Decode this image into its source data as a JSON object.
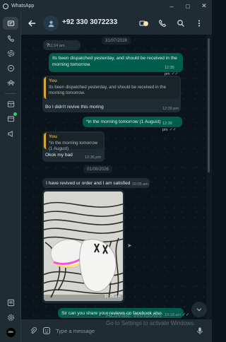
{
  "window": {
    "title": "WhatsApp",
    "controls": [
      "minimize",
      "maximize",
      "close"
    ]
  },
  "colors": {
    "accent": "#25d366",
    "bubble_out": "#005c4b",
    "bubble_in": "#202c33",
    "quote_bar": "#d9a433",
    "read_ticks": "#53bdeb"
  },
  "rail": {
    "top_icons": [
      "chats-icon",
      "calls-icon",
      "status-icon",
      "channels-icon",
      "communities-icon"
    ],
    "mid_icons": [
      "archive-icon",
      "starred-icon",
      "broadcast-icon"
    ],
    "bottom_icons": [
      "media-icon",
      "settings-icon",
      "profile-avatar"
    ],
    "profile_text": "ZEN"
  },
  "header": {
    "contact_name": "+92 330 3072233",
    "icons": [
      "back-arrow-icon",
      "contact-avatar-icon",
      "video-call-icon",
      "voice-call-icon",
      "search-icon",
      "more-options-icon"
    ]
  },
  "messages": [
    {
      "type": "date",
      "text": "31/07/2026"
    },
    {
      "type": "in",
      "text": "?",
      "time": "11:14 am"
    },
    {
      "type": "out",
      "text": "Its been dispatched yesterday, and should be received in the morning tomorrow.",
      "time": "12:35 pm",
      "status": "read"
    },
    {
      "type": "in",
      "quote_author": "You",
      "quote_text": "Its been dispatched yesterday, and should be received in the morning tomorrow.",
      "text": "Bo I didn't revive this moring",
      "time": "12:35 pm"
    },
    {
      "type": "out",
      "text": "*in the morning tomorrow (1 August)",
      "time": "12:36 pm",
      "status": "read"
    },
    {
      "type": "in",
      "quote_author": "You",
      "quote_text": "*in the morning tomorrow (1 August)",
      "text": "Okok my bad",
      "time": "12:36 pm"
    },
    {
      "type": "date",
      "text": "01/08/2026"
    },
    {
      "type": "in",
      "text": "I have revived ur order and I am satisfied",
      "time": "10:05 am"
    },
    {
      "type": "in-image",
      "caption": "",
      "time": "10:05 am"
    },
    {
      "type": "out",
      "text": "Sir can you share your reviews on facebook also.",
      "time": "10:18 am",
      "status": "read"
    }
  ],
  "composer": {
    "placeholder": "Type a message",
    "icons": [
      "attach-icon",
      "sticker-icon",
      "mic-icon"
    ]
  },
  "watermark": {
    "line1": "Activate Windows",
    "line2": "Go to Settings to activate Windows."
  }
}
